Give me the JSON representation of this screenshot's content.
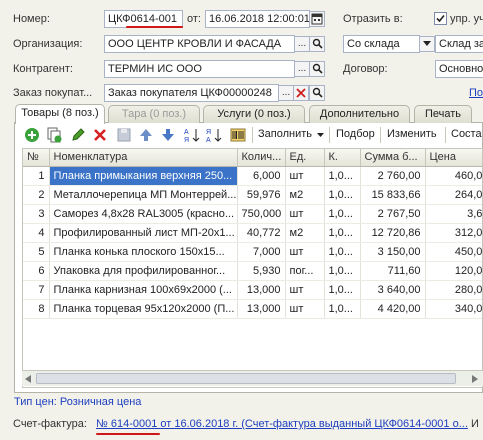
{
  "header": {
    "number_label": "Номер:",
    "number_value": "ЦКФ0614-001",
    "date_from_label": "от:",
    "date_value": "16.06.2018 12:00:01",
    "reflect_label": "Отразить в:",
    "reflect_checkbox_label": "упр. учет",
    "org_label": "Организация:",
    "org_value": "ООО ЦЕНТР КРОВЛИ И ФАСАДА",
    "warehouse_mode_value": "Со склада",
    "warehouse_value": "Склад за",
    "contractor_label": "Контрагент:",
    "contractor_value": "ТЕРМИН ИС ООО",
    "contract_label": "Договор:",
    "contract_value": "Основной",
    "order_label": "Заказ покупат...",
    "order_value": "Заказ покупателя ЦКФ00000248",
    "order_link": "По"
  },
  "tabs": [
    {
      "label": "Товары (8 поз.)"
    },
    {
      "label": "Тара (0 поз.)"
    },
    {
      "label": "Услуги (0 поз.)"
    },
    {
      "label": "Дополнительно"
    },
    {
      "label": "Печать"
    }
  ],
  "toolbar": {
    "fill_label": "Заполнить",
    "selection_label": "Подбор",
    "change_label": "Изменить",
    "last_label": "Соста"
  },
  "table": {
    "columns": [
      "№",
      "Номенклатура",
      "Колич...",
      "Ед.",
      "К.",
      "Сумма б...",
      "Цена"
    ],
    "rows": [
      {
        "n": "1",
        "name": "Планка примыкания верхняя 250...",
        "qty": "6,000",
        "unit": "шт",
        "k": "1,0...",
        "sum": "2 760,00",
        "price": "460,00"
      },
      {
        "n": "2",
        "name": "Металлочерепица МП Монтеррей...",
        "qty": "59,976",
        "unit": "м2",
        "k": "1,0...",
        "sum": "15 833,66",
        "price": "264,00"
      },
      {
        "n": "3",
        "name": "Саморез 4,8х28 RAL3005 (красно...",
        "qty": "750,000",
        "unit": "шт",
        "k": "1,0...",
        "sum": "2 767,50",
        "price": "3,69"
      },
      {
        "n": "4",
        "name": "Профилированный лист МП-20х1...",
        "qty": "40,772",
        "unit": "м2",
        "k": "1,0...",
        "sum": "12 720,86",
        "price": "312,00"
      },
      {
        "n": "5",
        "name": "Планка конька плоского 150х15...",
        "qty": "7,000",
        "unit": "шт",
        "k": "1,0...",
        "sum": "3 150,00",
        "price": "450,00"
      },
      {
        "n": "6",
        "name": "Упаковка для профилированног...",
        "qty": "5,930",
        "unit": "пог...",
        "k": "1,0...",
        "sum": "711,60",
        "price": "120,00"
      },
      {
        "n": "7",
        "name": "Планка карнизная 100х69х2000 (...",
        "qty": "13,000",
        "unit": "шт",
        "k": "1,0...",
        "sum": "3 640,00",
        "price": "280,00"
      },
      {
        "n": "8",
        "name": "Планка торцевая 95х120х2000 (П...",
        "qty": "13,000",
        "unit": "шт",
        "k": "1,0...",
        "sum": "4 420,00",
        "price": "340,00"
      }
    ]
  },
  "footer": {
    "price_type_text": "Тип цен: Розничная цена",
    "invoice_label": "Счет-фактура:",
    "invoice_link": "№ 614-0001 от 16.06.2018 г. (Счет-фактура выданный ЦКФ0614-0001 о...",
    "invoice_tail": "И"
  },
  "colors": {
    "annotation_red": "#d01818",
    "selection_blue": "#3a73c7",
    "link_blue": "#1d3fbf"
  }
}
